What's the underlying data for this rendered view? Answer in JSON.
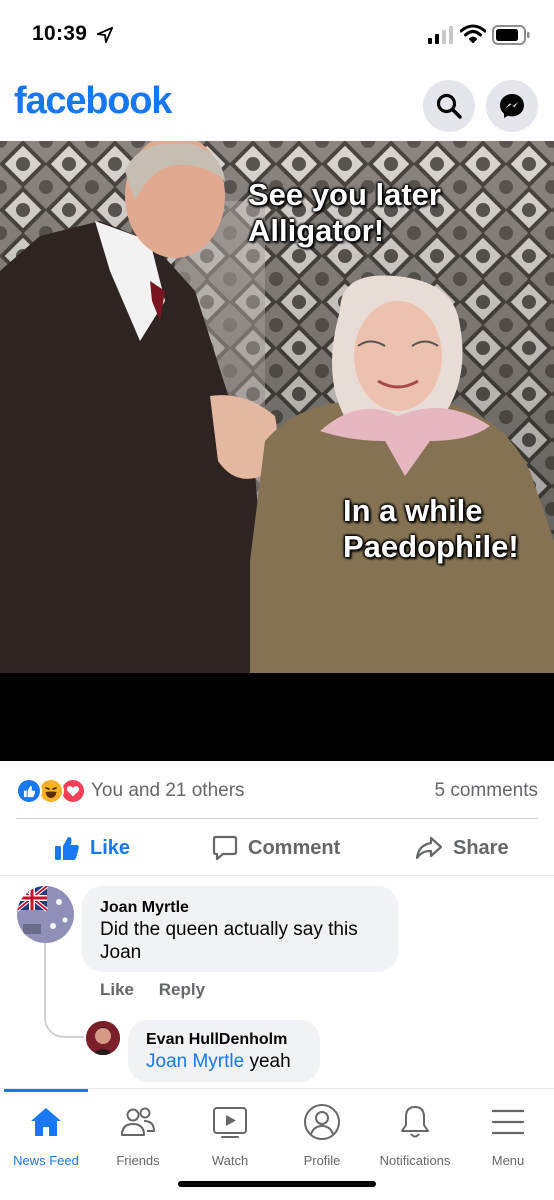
{
  "status_bar": {
    "time": "10:39",
    "icons": [
      "location-arrow-icon",
      "cellular-signal-icon",
      "wifi-icon",
      "battery-icon"
    ]
  },
  "header": {
    "logo": "facebook",
    "brand_color": "#1877f2",
    "icons": [
      "search-icon",
      "messenger-icon"
    ]
  },
  "post": {
    "image_caption_top": "See you later Alligator!",
    "image_caption_bottom": "In a while Paedophile!",
    "reactions": {
      "types": [
        "like",
        "haha",
        "love"
      ],
      "summary": "You and 21 others",
      "comments_count": "5 comments"
    },
    "actions": {
      "like": "Like",
      "comment": "Comment",
      "share": "Share"
    }
  },
  "comments": [
    {
      "author": "Joan Myrtle",
      "text": "Did the queen actually say this Joan",
      "actions": {
        "like": "Like",
        "reply": "Reply"
      }
    },
    {
      "author": "Evan HullDenholm",
      "mention": "Joan Myrtle",
      "text": "yeah"
    }
  ],
  "tab_bar": {
    "active": "News Feed",
    "tabs": [
      {
        "label": "News Feed",
        "icon": "home-icon"
      },
      {
        "label": "Friends",
        "icon": "friends-icon"
      },
      {
        "label": "Watch",
        "icon": "watch-icon"
      },
      {
        "label": "Profile",
        "icon": "profile-icon"
      },
      {
        "label": "Notifications",
        "icon": "bell-icon"
      },
      {
        "label": "Menu",
        "icon": "menu-icon"
      }
    ]
  }
}
